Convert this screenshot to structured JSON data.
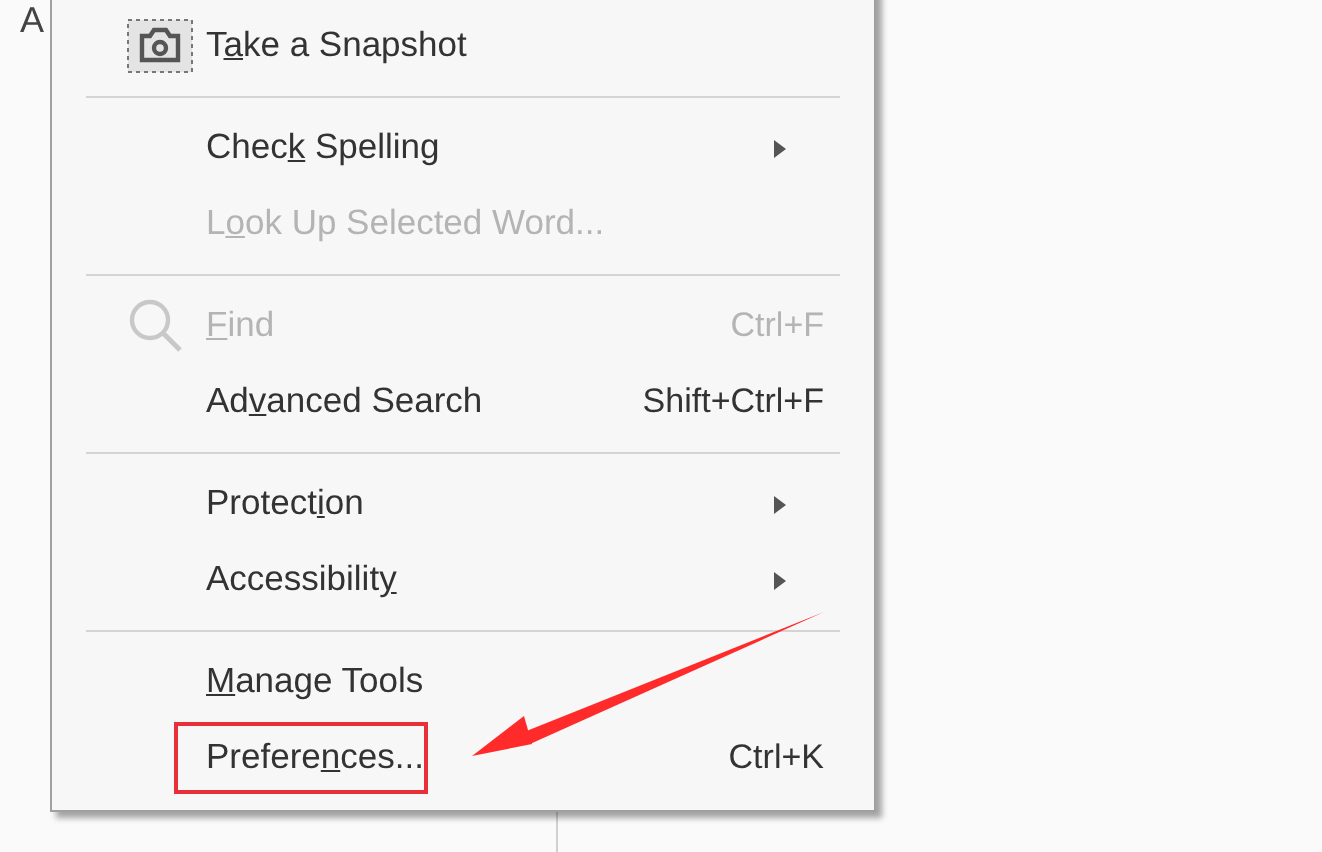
{
  "background_text": "A",
  "menu": {
    "groups": [
      {
        "items": [
          {
            "kind": "snapshot",
            "pre": "T",
            "key": "a",
            "post": "ke a Snapshot",
            "disabled": false,
            "submenu": false,
            "highlighted": false
          }
        ]
      },
      {
        "items": [
          {
            "kind": "plain",
            "pre": "Chec",
            "key": "k",
            "post": " Spelling",
            "disabled": false,
            "submenu": true,
            "highlighted": false
          },
          {
            "kind": "plain",
            "pre": "L",
            "key": "o",
            "post": "ok Up Selected Word...",
            "disabled": true,
            "submenu": false,
            "highlighted": false
          }
        ]
      },
      {
        "items": [
          {
            "kind": "find",
            "key": "F",
            "post": "ind",
            "shortcut": "Ctrl+F",
            "disabled": true,
            "submenu": false,
            "highlighted": false
          },
          {
            "kind": "plain",
            "pre": "Ad",
            "key": "v",
            "post": "anced Search",
            "shortcut": "Shift+Ctrl+F",
            "disabled": false,
            "submenu": false,
            "highlighted": false
          }
        ]
      },
      {
        "items": [
          {
            "kind": "plain",
            "pre": "Protect",
            "key": "i",
            "post": "on",
            "disabled": false,
            "submenu": true,
            "highlighted": false
          },
          {
            "kind": "plain",
            "pre": "Accessibilit",
            "key": "y",
            "disabled": false,
            "submenu": true,
            "highlighted": false
          }
        ]
      },
      {
        "items": [
          {
            "kind": "plain",
            "key": "M",
            "post": "anage Tools",
            "disabled": false,
            "submenu": false,
            "highlighted": false
          },
          {
            "kind": "plain",
            "pre": "Prefere",
            "key": "n",
            "post": "ces...",
            "shortcut": "Ctrl+K",
            "disabled": false,
            "submenu": false,
            "highlighted": true
          }
        ]
      }
    ]
  }
}
